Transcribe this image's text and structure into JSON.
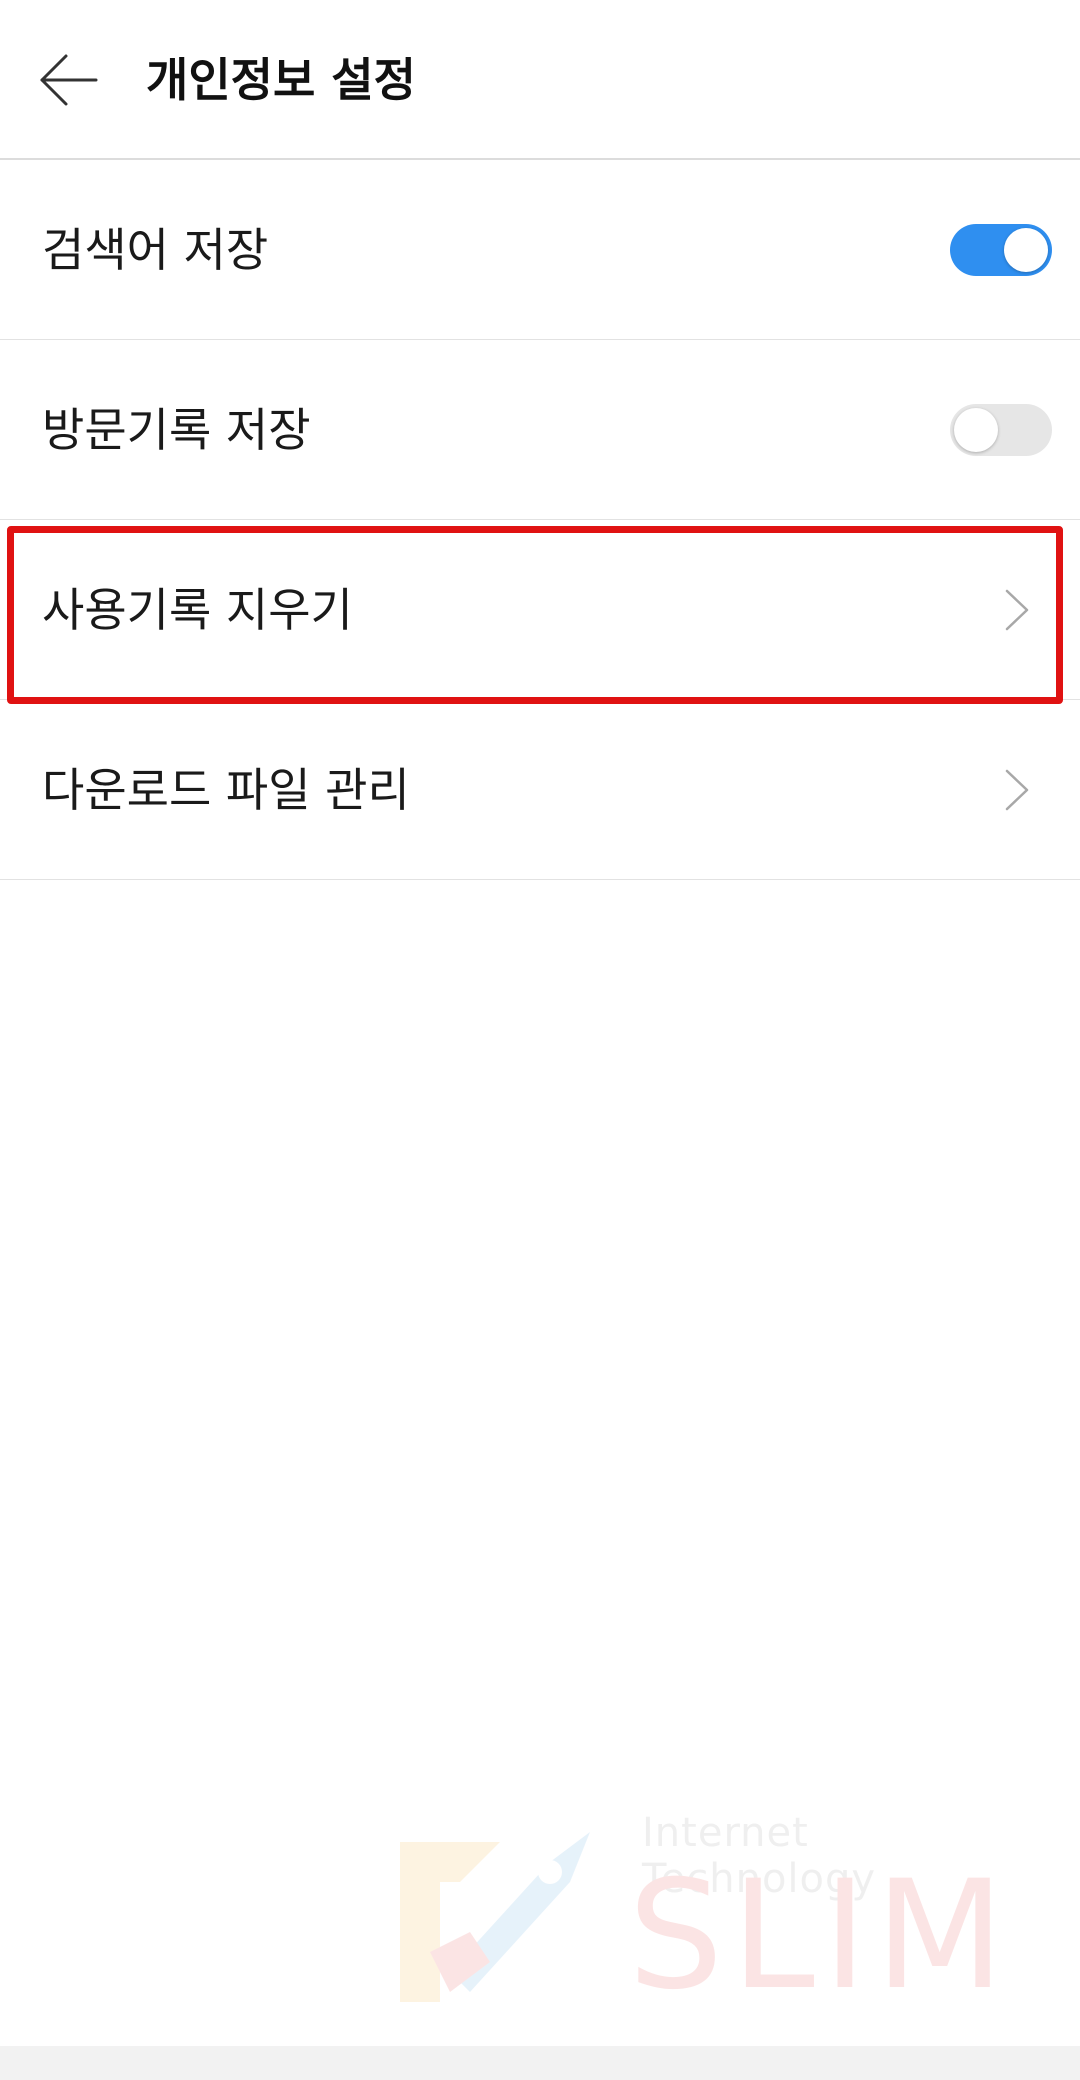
{
  "header": {
    "title": "개인정보 설정"
  },
  "settings": [
    {
      "label": "검색어 저장",
      "control": "toggle",
      "enabled": true
    },
    {
      "label": "방문기록 저장",
      "control": "toggle",
      "enabled": false
    },
    {
      "label": "사용기록 지우기",
      "control": "chevron",
      "highlighted": true
    },
    {
      "label": "다운로드 파일 관리",
      "control": "chevron"
    }
  ],
  "icons": {
    "back": "arrow-left-icon",
    "chevron": "chevron-right-icon"
  },
  "colors": {
    "toggle_on": "#2f8ff0",
    "toggle_off": "#e6e6e6",
    "highlight": "#e01212"
  },
  "watermark": {
    "subtitle": "Internet Technology",
    "brand": "SLIM"
  }
}
